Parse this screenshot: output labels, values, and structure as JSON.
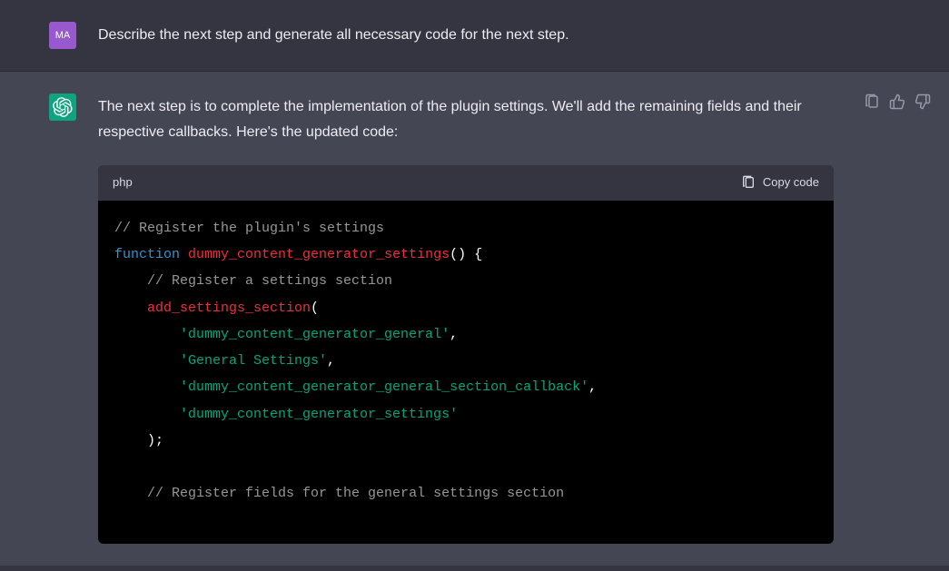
{
  "user": {
    "avatar_initials": "MA",
    "message": "Describe the next step and generate all necessary code for the next step."
  },
  "assistant": {
    "message": "The next step is to complete the implementation of the plugin settings. We'll add the remaining fields and their respective callbacks. Here's the updated code:"
  },
  "code": {
    "language": "php",
    "copy_label": "Copy code",
    "lines": {
      "l1": "// Register the plugin's settings",
      "l2_kw": "function",
      "l2_fn": "dummy_content_generator_settings",
      "l2_tail": "() {",
      "l3": "// Register a settings section",
      "l4_fn": "add_settings_section",
      "l4_tail": "(",
      "l5": "'dummy_content_generator_general'",
      "l6": "'General Settings'",
      "l7": "'dummy_content_generator_general_section_callback'",
      "l8": "'dummy_content_generator_settings'",
      "l9": ");",
      "l10": "// Register fields for the general settings section"
    }
  }
}
